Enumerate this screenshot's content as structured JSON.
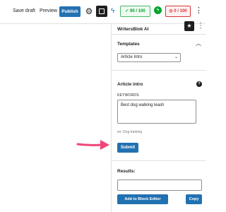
{
  "toolbar": {
    "save_draft": "Save draft",
    "preview": "Preview",
    "publish": "Publish",
    "score_green": "90 / 100",
    "score_pink": "0 / 100",
    "more": "⋮"
  },
  "sidebar": {
    "title": "WritersBlok AI",
    "templates_label": "Templates",
    "template_selected": "Article Intro",
    "section_title": "Article intro",
    "keywords_label": "KEYWORDS",
    "keywords_value": "Best dog walking leash",
    "keywords_hint": "ex: Dog training",
    "submit": "Submit",
    "results_label": "Results:",
    "results_value": "",
    "add_to_block_editor": "Add to Block Editor",
    "copy": "Copy",
    "help": "?"
  },
  "colors": {
    "accent": "#2271b1",
    "green": "#00a32a",
    "pink": "#d63638",
    "arrow": "#f0457a"
  }
}
